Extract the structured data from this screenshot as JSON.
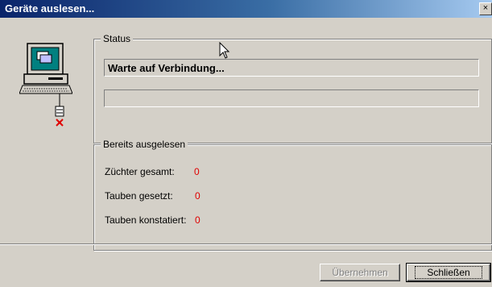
{
  "window": {
    "title": "Geräte auslesen...",
    "close_glyph": "×"
  },
  "status": {
    "legend": "Status",
    "message": "Warte auf Verbindung...",
    "progress": 0
  },
  "read": {
    "legend": "Bereits ausgelesen",
    "rows": [
      {
        "label": "Züchter gesamt:",
        "value": "0"
      },
      {
        "label": "Tauben gesetzt:",
        "value": "0"
      },
      {
        "label": "Tauben konstatiert:",
        "value": "0"
      }
    ]
  },
  "buttons": {
    "apply_label": "Übernehmen",
    "close_label": "Schließen"
  },
  "colors": {
    "title_start": "#0a246a",
    "value_red": "#e00000",
    "face": "#d4d0c8"
  },
  "icons": {
    "device": "computer-icon",
    "cursor": "mouse-pointer-icon"
  }
}
